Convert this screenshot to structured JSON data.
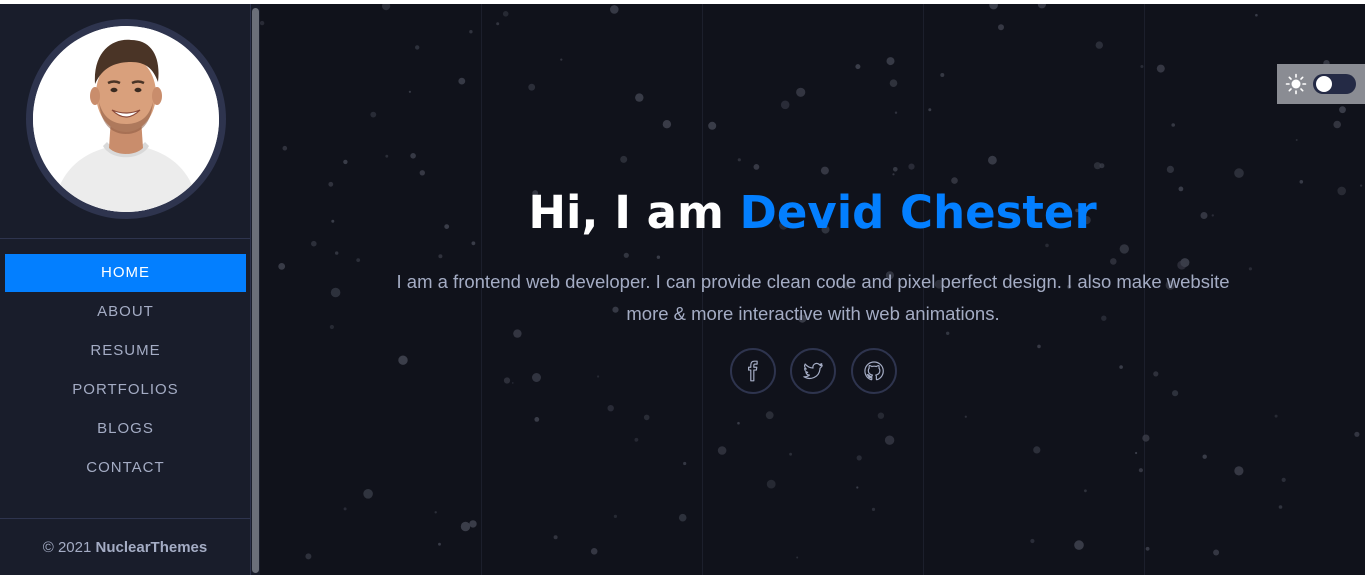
{
  "sidebar": {
    "avatar_alt": "Profile photo",
    "nav": [
      {
        "label": "HOME",
        "active": true
      },
      {
        "label": "ABOUT",
        "active": false
      },
      {
        "label": "RESUME",
        "active": false
      },
      {
        "label": "PORTFOLIOS",
        "active": false
      },
      {
        "label": "BLOGS",
        "active": false
      },
      {
        "label": "CONTACT",
        "active": false
      }
    ],
    "copyright_prefix": "© 2021",
    "copyright_brand": "NuclearThemes"
  },
  "hero": {
    "greeting": "Hi, I am",
    "name": "Devid Chester",
    "description": "I am a frontend web developer. I can provide clean code and pixel perfect design. I also make website more & more interactive with web animations."
  },
  "socials": [
    {
      "icon": "facebook-icon"
    },
    {
      "icon": "twitter-icon"
    },
    {
      "icon": "github-icon"
    }
  ],
  "theme_toggle": {
    "icon": "sun-icon",
    "mode": "dark"
  },
  "colors": {
    "accent": "#037fff",
    "sidebar_bg": "#191d2b",
    "main_bg": "#10121b",
    "text_muted": "#a4acc4",
    "border": "#2e344e"
  }
}
